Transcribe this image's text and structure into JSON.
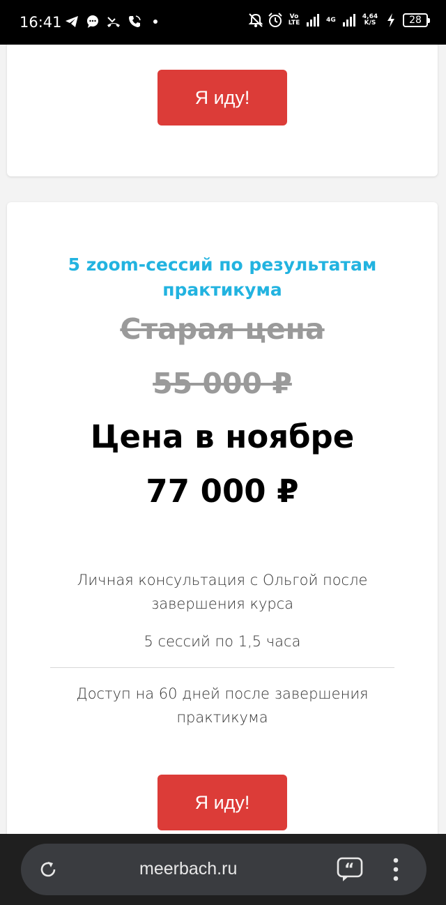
{
  "status_bar": {
    "time": "16:41",
    "volte": "Vo LTE",
    "network": "4G",
    "speed_value": "4,64",
    "speed_unit": "K/S",
    "battery": "28"
  },
  "top_card": {
    "cta_label": "Я иду!"
  },
  "offer": {
    "title": "5 zoom-сессий по результатам практикума",
    "old_price_label": "Старая цена",
    "old_price": "55 000 ₽",
    "new_price_label": "Цена в ноябре",
    "new_price": "77 000 ₽",
    "features": [
      "Личная консультация с Ольгой после завершения курса",
      "5 сессий по 1,5 часа",
      "Доступ на 60 дней после завершения практикума"
    ],
    "cta_label": "Я иду!"
  },
  "browser": {
    "url": "meerbach.ru"
  },
  "colors": {
    "accent_blue": "#22b3e0",
    "button_red": "#dc3c38",
    "old_price_gray": "#9a9a9a"
  }
}
